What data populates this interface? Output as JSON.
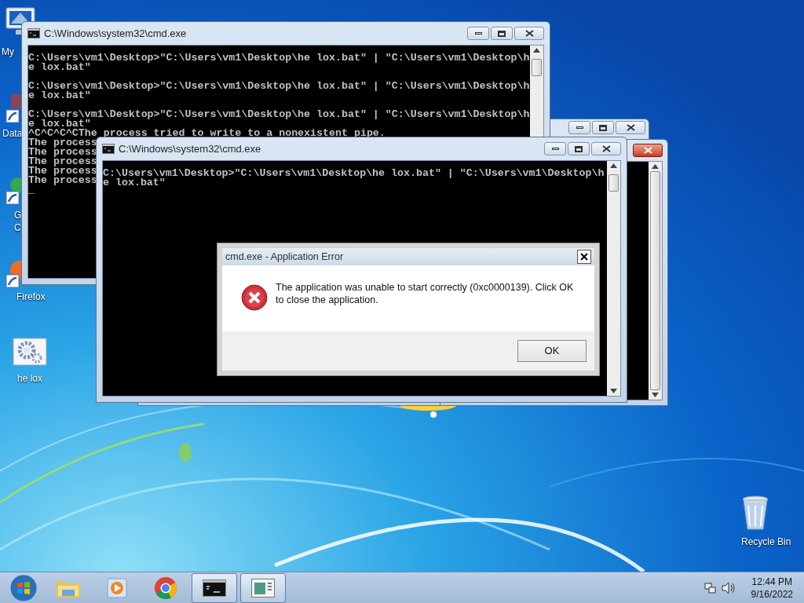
{
  "desktop_icons": [
    {
      "kind": "computer",
      "label_lines": [
        "My"
      ]
    },
    {
      "kind": "database",
      "label_lines": [
        "Data"
      ]
    },
    {
      "kind": "chrome",
      "label_lines": [
        "G",
        "C"
      ]
    },
    {
      "kind": "firefox",
      "label_lines": [
        "Firefox"
      ]
    },
    {
      "kind": "settings",
      "label_lines": [
        "he lox"
      ]
    },
    {
      "kind": "recycle",
      "label_lines": [
        "Recycle Bin"
      ]
    }
  ],
  "back_window": {
    "title": "C:\\Windows\\system32\\cmd.exe",
    "blocks": [
      [
        "C:\\Users\\vm1\\Desktop>\"C:\\Users\\vm1\\Desktop\\he lox.bat\" | \"C:\\Users\\vm1\\Desktop\\h",
        "e lox.bat\""
      ],
      [
        "C:\\Users\\vm1\\Desktop>\"C:\\Users\\vm1\\Desktop\\he lox.bat\" | \"C:\\Users\\vm1\\Desktop\\h",
        "e lox.bat\""
      ],
      [
        "C:\\Users\\vm1\\Desktop>\"C:\\Users\\vm1\\Desktop\\he lox.bat\" | \"C:\\Users\\vm1\\Desktop\\h",
        "e lox.bat\"",
        "^C^C^C^CThe process tried to write to a nonexistent pipe.",
        "The process",
        "The process",
        "The process",
        "The process",
        "The process",
        "_"
      ]
    ]
  },
  "front_window": {
    "title": "C:\\Windows\\system32\\cmd.exe",
    "blocks": [
      [
        "C:\\Users\\vm1\\Desktop>\"C:\\Users\\vm1\\Desktop\\he lox.bat\" | \"C:\\Users\\vm1\\Desktop\\h",
        "e lox.bat\""
      ]
    ]
  },
  "dialog": {
    "title": "cmd.exe - Application Error",
    "message": "The application was unable to start correctly (0xc0000139). Click OK to close the application.",
    "button": "OK"
  },
  "taskbar": {
    "items": [
      {
        "kind": "start",
        "active": false
      },
      {
        "kind": "folder",
        "active": false
      },
      {
        "kind": "media",
        "active": false
      },
      {
        "kind": "chrome",
        "active": false
      },
      {
        "kind": "console",
        "active": true
      },
      {
        "kind": "document",
        "active": true
      }
    ],
    "time": "12:44 PM",
    "date": "9/16/2022"
  }
}
